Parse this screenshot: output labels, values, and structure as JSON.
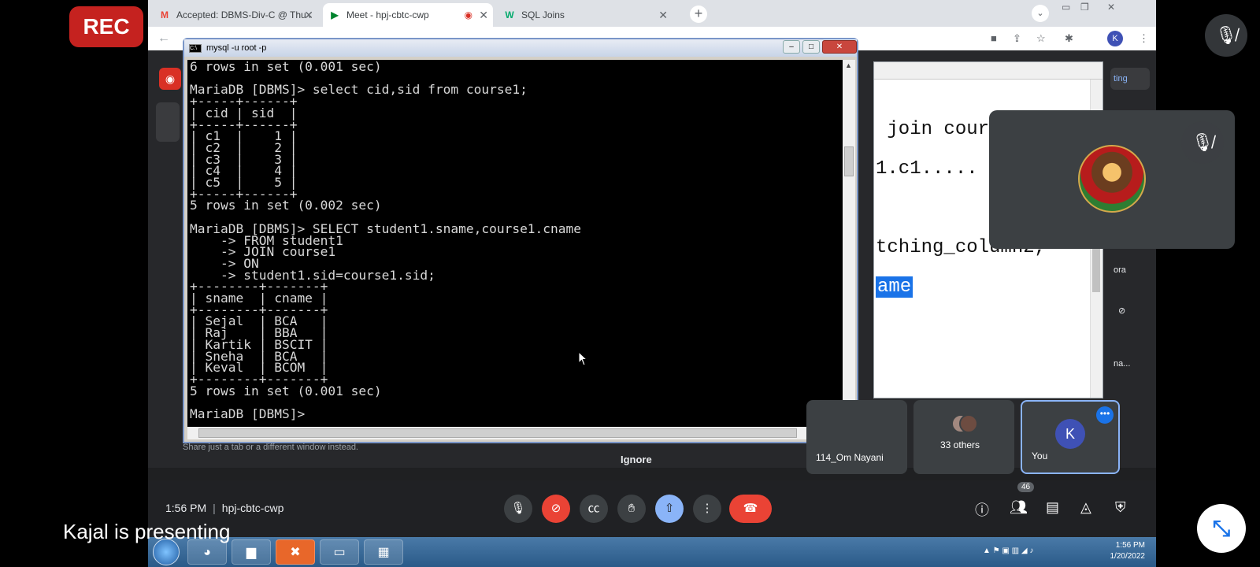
{
  "recording_label": "REC",
  "presenter_caption": "Kajal is presenting",
  "browser": {
    "tabs": [
      {
        "label": "Accepted: DBMS-Div-C @ Thu Ja",
        "favicon": "M"
      },
      {
        "label": "Meet - hpj-cbtc-cwp",
        "favicon": "▶"
      },
      {
        "label": "SQL Joins",
        "favicon": "W"
      }
    ],
    "profile_initial": "K"
  },
  "console": {
    "title": "mysql  -u root -p",
    "lines": [
      "6 rows in set (0.001 sec)",
      "",
      "MariaDB [DBMS]> select cid,sid from course1;",
      "+-----+------+",
      "| cid | sid  |",
      "+-----+------+",
      "| c1  |    1 |",
      "| c2  |    2 |",
      "| c3  |    3 |",
      "| c4  |    4 |",
      "| c5  |    5 |",
      "+-----+------+",
      "5 rows in set (0.002 sec)",
      "",
      "MariaDB [DBMS]> SELECT student1.sname,course1.cname",
      "    -> FROM student1",
      "    -> JOIN course1",
      "    -> ON",
      "    -> student1.sid=course1.sid;",
      "+--------+-------+",
      "| sname  | cname |",
      "+--------+-------+",
      "| Sejal  | BCA   |",
      "| Raj    | BBA   |",
      "| Kartik | BSCIT |",
      "| Sneha  | BCA   |",
      "| Keval  | BCOM  |",
      "+--------+-------+",
      "5 rows in set (0.001 sec)",
      "",
      "MariaDB [DBMS]>"
    ]
  },
  "doc": {
    "line1": " join cour",
    "line2": "1.c1.....",
    "line3": "tching_column2,",
    "line4_highlight": "ame"
  },
  "side_labels": {
    "top": "ting",
    "mid": "ora",
    "low": "na..."
  },
  "share_notice": "Share just a tab or a different window instead.",
  "ignore_label": "Ignore",
  "participants": [
    {
      "name": "114_Om Nayani"
    },
    {
      "name": "33 others"
    },
    {
      "name": "You",
      "initial": "K"
    }
  ],
  "meeting": {
    "time": "1:56 PM",
    "code": "hpj-cbtc-cwp",
    "participant_count": "46"
  },
  "taskbar": {
    "time": "1:56 PM",
    "date": "1/20/2022"
  }
}
